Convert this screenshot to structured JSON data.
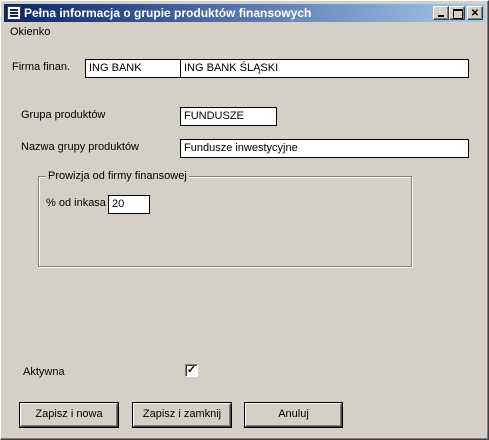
{
  "window": {
    "title": "Pełna informacja o grupie produktów finansowych"
  },
  "menu": {
    "items": [
      {
        "label": "Okienko"
      }
    ]
  },
  "form": {
    "firma_label": "Firma finan.",
    "firma_code": "ING BANK",
    "firma_name": "ING BANK ŚLĄSKI",
    "grupa_label": "Grupa produktów",
    "grupa_value": "FUNDUSZE",
    "nazwa_label": "Nazwa grupy produktów",
    "nazwa_value": "Fundusze inwestycyjne",
    "prowizja_group_label": "Prowizja od firmy finansowej",
    "procent_label": "% od inkasa",
    "procent_value": "20",
    "aktywna_label": "Aktywna",
    "aktywna_checked": true,
    "aktywna_mark": "✓"
  },
  "buttons": {
    "zapisz_nowa": "Zapisz i nowa",
    "zapisz_zamknij": "Zapisz i zamknij",
    "anuluj": "Anuluj"
  }
}
